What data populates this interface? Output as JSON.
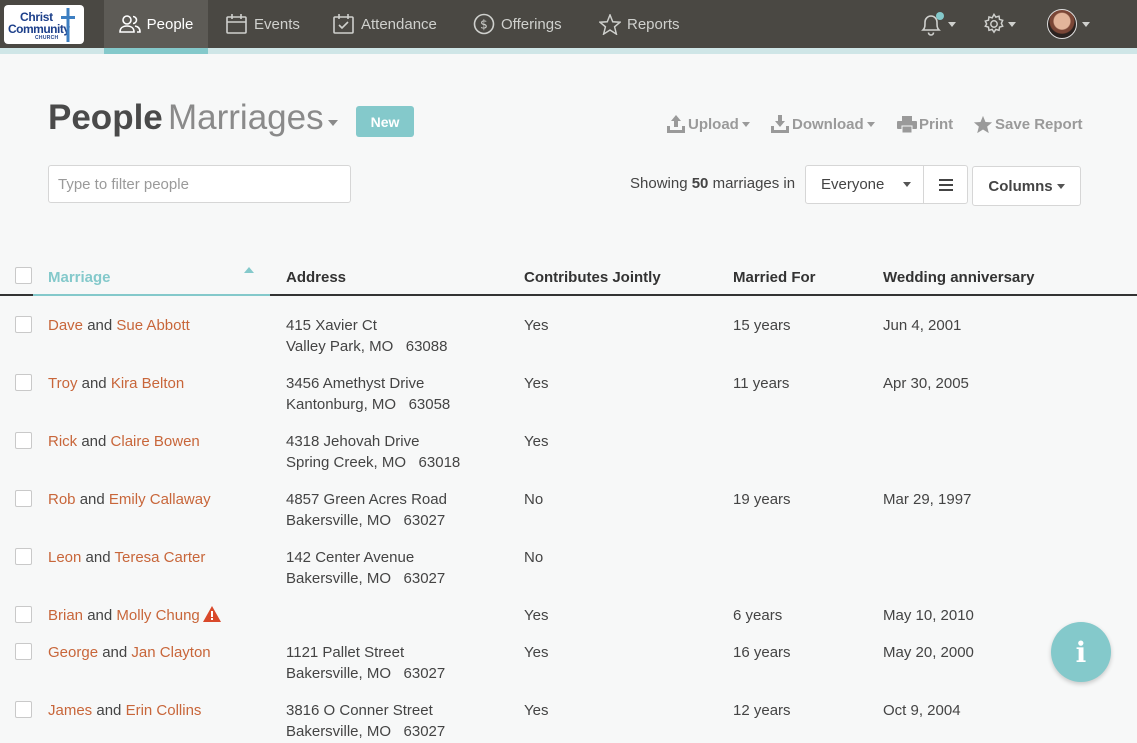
{
  "logo": {
    "line1": "Christ",
    "line2": "Community",
    "line3": "CHURCH"
  },
  "nav": {
    "items": [
      {
        "label": "People",
        "icon": "people-icon",
        "active": true
      },
      {
        "label": "Events",
        "icon": "calendar-icon"
      },
      {
        "label": "Attendance",
        "icon": "checkbox-calendar-icon"
      },
      {
        "label": "Offerings",
        "icon": "dollar-circle-icon"
      },
      {
        "label": "Reports",
        "icon": "star-icon"
      }
    ],
    "notification_dot_color": "#84c9cb"
  },
  "header": {
    "title": "People",
    "subtitle": "Marriages",
    "new_label": "New",
    "actions": [
      {
        "label": "Upload",
        "icon": "upload-icon"
      },
      {
        "label": "Download",
        "icon": "download-icon"
      },
      {
        "label": "Print",
        "icon": "print-icon"
      },
      {
        "label": "Save Report",
        "icon": "star-icon"
      }
    ]
  },
  "filter": {
    "placeholder": "Type to filter people",
    "showing_prefix": "Showing",
    "showing_count": "50",
    "showing_suffix": "marriages in",
    "scope": "Everyone",
    "columns_label": "Columns"
  },
  "table": {
    "columns": [
      "Marriage",
      "Address",
      "Contributes Jointly",
      "Married For",
      "Wedding anniversary"
    ],
    "sorted_column": "Marriage",
    "rows": [
      {
        "p1": "Dave",
        "and": "and",
        "p2": "Sue Abbott",
        "addr1": "415 Xavier Ct",
        "addr2": "Valley Park, MO   63088",
        "jointly": "Yes",
        "married_for": "15 years",
        "anniversary": "Jun 4, 2001"
      },
      {
        "p1": "Troy",
        "and": "and",
        "p2": "Kira Belton",
        "addr1": "3456 Amethyst Drive",
        "addr2": "Kantonburg, MO   63058",
        "jointly": "Yes",
        "married_for": "11 years",
        "anniversary": "Apr 30, 2005"
      },
      {
        "p1": "Rick",
        "and": "and",
        "p2": "Claire Bowen",
        "addr1": "4318 Jehovah Drive",
        "addr2": "Spring Creek, MO   63018",
        "jointly": "Yes",
        "married_for": "",
        "anniversary": ""
      },
      {
        "p1": "Rob",
        "and": "and",
        "p2": "Emily Callaway",
        "addr1": "4857 Green Acres Road",
        "addr2": "Bakersville, MO   63027",
        "jointly": "No",
        "married_for": "19 years",
        "anniversary": "Mar 29, 1997"
      },
      {
        "p1": "Leon",
        "and": "and",
        "p2": "Teresa Carter",
        "addr1": "142 Center Avenue",
        "addr2": "Bakersville, MO   63027",
        "jointly": "No",
        "married_for": "",
        "anniversary": ""
      },
      {
        "p1": "Brian",
        "and": "and",
        "p2": "Molly Chung",
        "addr1": "",
        "addr2": "",
        "jointly": "Yes",
        "married_for": "6 years",
        "anniversary": "May 10, 2010",
        "warning": true
      },
      {
        "p1": "George",
        "and": "and",
        "p2": "Jan Clayton",
        "addr1": "1121 Pallet Street",
        "addr2": "Bakersville, MO   63027",
        "jointly": "Yes",
        "married_for": "16 years",
        "anniversary": "May 20, 2000"
      },
      {
        "p1": "James",
        "and": "and",
        "p2": "Erin Collins",
        "addr1": "3816 O Conner Street",
        "addr2": "Bakersville, MO   63027",
        "jointly": "Yes",
        "married_for": "12 years",
        "anniversary": "Oct 9, 2004"
      }
    ]
  },
  "colors": {
    "accent": "#84c9cb",
    "link": "#c8663a",
    "nav_bg": "#4a4843",
    "warning": "#d9492b"
  },
  "fab": {
    "icon": "info-icon",
    "label": "i"
  }
}
